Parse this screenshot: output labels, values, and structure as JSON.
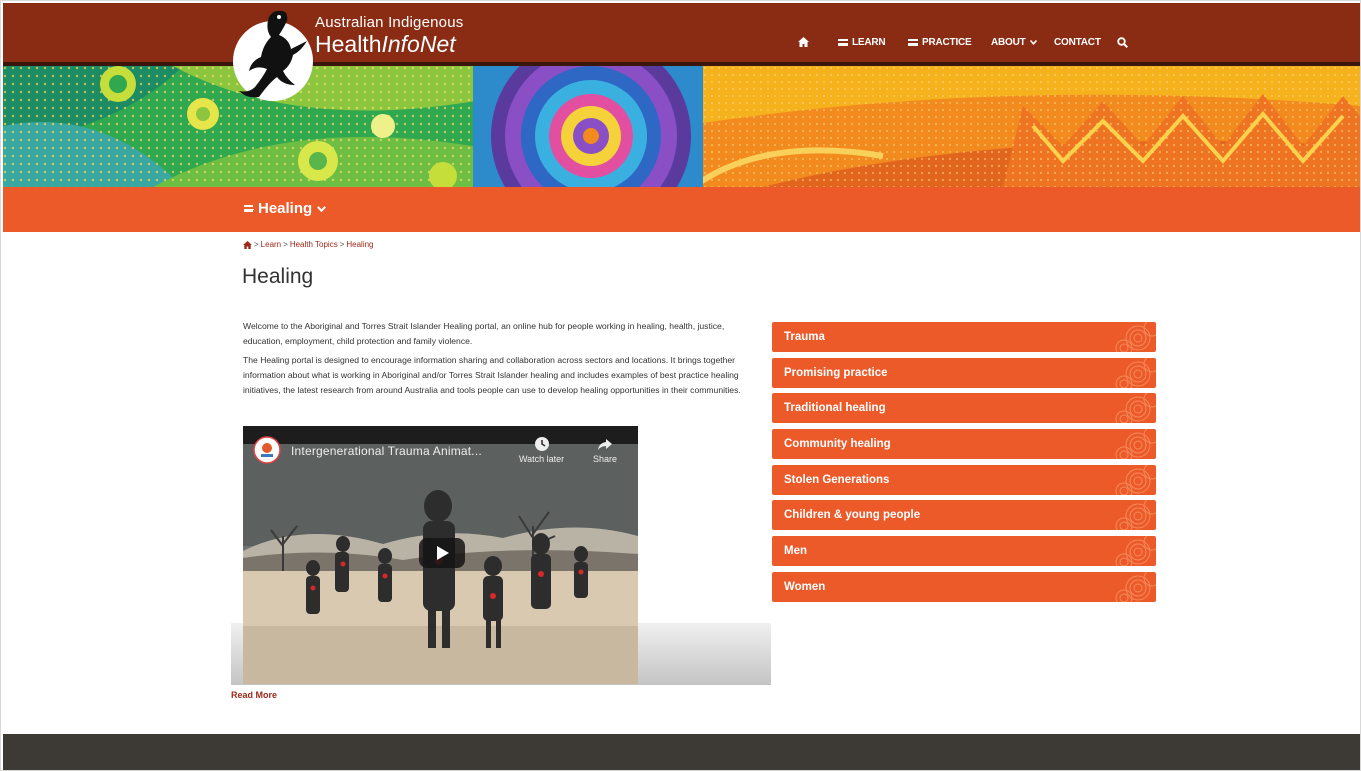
{
  "logo": {
    "line1": "Australian Indigenous",
    "line2a": "Health",
    "line2b": "InfoNet"
  },
  "nav": {
    "home_icon": "home-icon",
    "learn": "LEARN",
    "practice": "PRACTICE",
    "about": "ABOUT",
    "contact": "CONTACT",
    "search_icon": "search-icon"
  },
  "section": {
    "title": "Healing"
  },
  "breadcrumb": {
    "home_icon": "home-icon",
    "items": [
      "Learn",
      "Health Topics",
      "Healing"
    ]
  },
  "page": {
    "title": "Healing",
    "intro_p1": "Welcome to the Aboriginal and Torres Strait Islander Healing portal, an online hub for people working in healing, health, justice, education, employment, child protection and family violence.",
    "intro_p2": "The Healing portal is designed to encourage information sharing and collaboration across sectors and locations. It brings together information about what is working in Aboriginal and/or Torres Strait Islander healing and includes examples of best practice healing initiatives, the latest research from around Australia and tools people can use to develop healing opportunities in their communities."
  },
  "video": {
    "title": "Intergenerational Trauma Animat...",
    "watch_later": "Watch later",
    "share": "Share"
  },
  "read_more": "Read More",
  "topics": [
    "Trauma",
    "Promising practice",
    "Traditional healing",
    "Community healing",
    "Stolen Generations",
    "Children & young people",
    "Men",
    "Women"
  ],
  "colors": {
    "topbar": "#8a2b14",
    "accent": "#ec5a2a",
    "link": "#9b2a1a",
    "footer": "#3d3a36"
  }
}
